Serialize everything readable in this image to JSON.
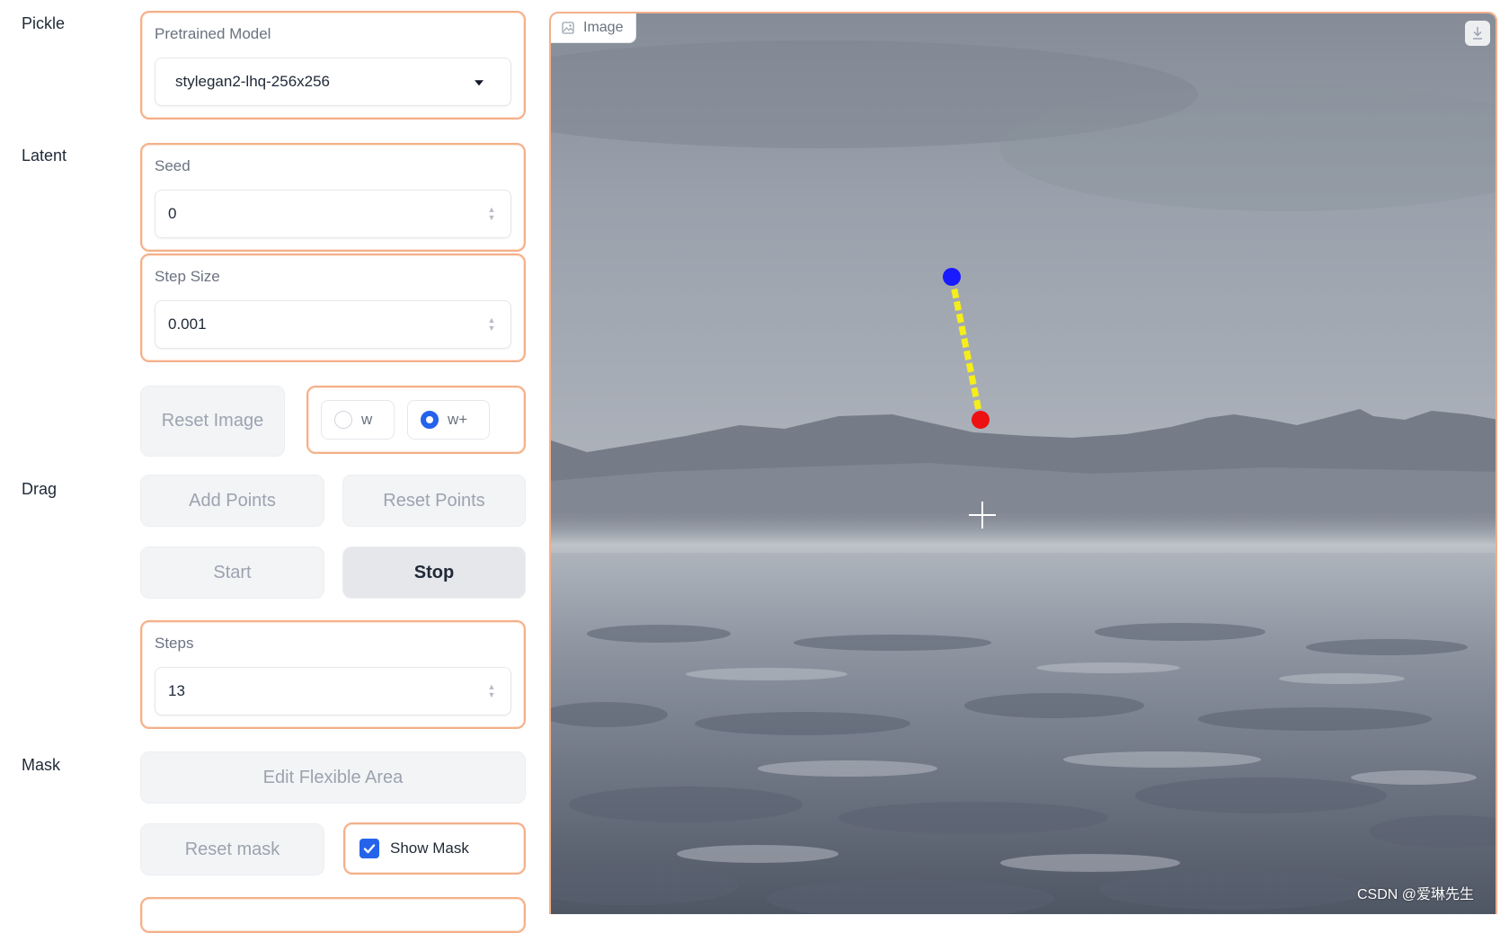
{
  "labels": {
    "pickle": "Pickle",
    "latent": "Latent",
    "drag": "Drag",
    "mask": "Mask"
  },
  "pretrained_model": {
    "title": "Pretrained Model",
    "value": "stylegan2-lhq-256x256"
  },
  "seed": {
    "title": "Seed",
    "value": "0"
  },
  "step_size": {
    "title": "Step Size",
    "value": "0.001"
  },
  "reset_image_label": "Reset Image",
  "latent_space": {
    "options": [
      "w",
      "w+"
    ],
    "selected": "w+"
  },
  "drag": {
    "add_points_label": "Add Points",
    "reset_points_label": "Reset Points",
    "start_label": "Start",
    "stop_label": "Stop"
  },
  "steps": {
    "title": "Steps",
    "value": "13"
  },
  "mask": {
    "edit_flexible_area_label": "Edit Flexible Area",
    "reset_mask_label": "Reset mask",
    "show_mask_label": "Show Mask",
    "show_mask_checked": true
  },
  "image_panel": {
    "tab_label": "Image",
    "icons": [
      "image-icon",
      "download-icon",
      "crosshair-cursor-icon"
    ],
    "handle_point_color": "#1a1aff",
    "target_point_color": "#ee1111",
    "drag_line_color": "#f5ee1a"
  },
  "watermark": "CSDN @爱琳先生",
  "colors": {
    "accent_border": "#f4b08a",
    "checkbox_blue": "#2563eb"
  }
}
